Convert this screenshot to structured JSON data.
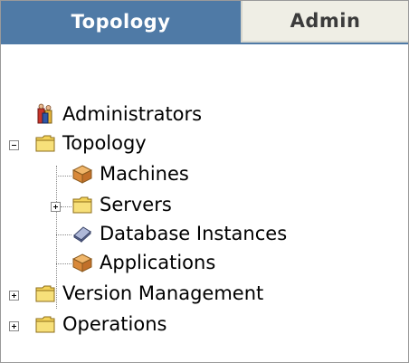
{
  "tabs": [
    {
      "label": "Topology",
      "active": true
    },
    {
      "label": "Admin",
      "active": false
    }
  ],
  "tree": {
    "administrators": {
      "label": "Administrators",
      "icon": "administrators-icon"
    },
    "topology": {
      "label": "Topology",
      "icon": "folder-icon",
      "expanded": true
    },
    "machines": {
      "label": "Machines",
      "icon": "box-icon"
    },
    "servers": {
      "label": "Servers",
      "icon": "folder-icon",
      "expanded": false
    },
    "database_instances": {
      "label": "Database Instances",
      "icon": "database-instance-icon"
    },
    "applications": {
      "label": "Applications",
      "icon": "box-icon"
    },
    "version_management": {
      "label": "Version Management",
      "icon": "folder-icon",
      "expanded": false
    },
    "operations": {
      "label": "Operations",
      "icon": "folder-icon",
      "expanded": false
    }
  },
  "colors": {
    "active_tab": "#4f7aa6",
    "inactive_tab": "#efeee5",
    "folder": "#f3d35a"
  }
}
